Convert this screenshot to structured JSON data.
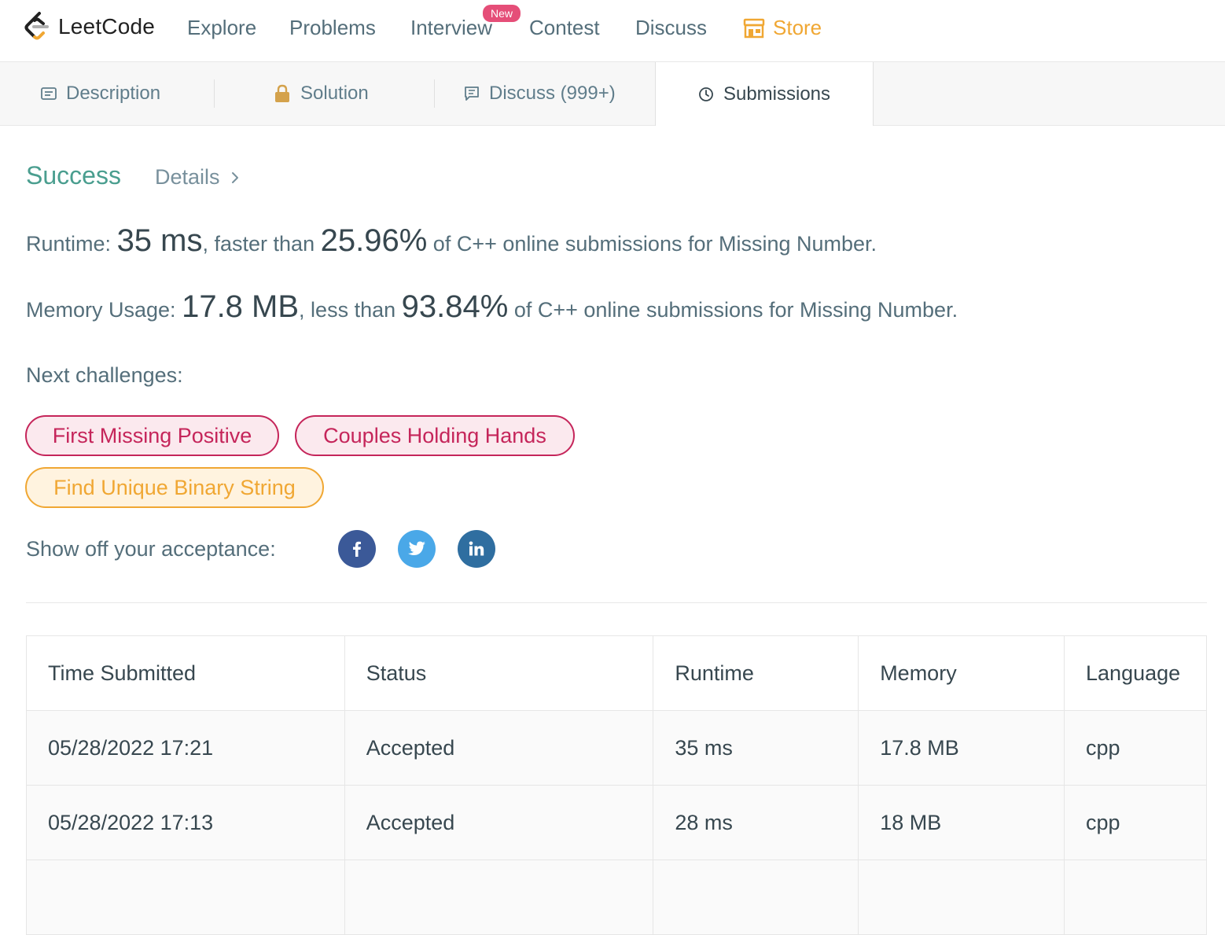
{
  "nav": {
    "logo_text": "LeetCode",
    "items": [
      "Explore",
      "Problems",
      "Interview",
      "Contest",
      "Discuss"
    ],
    "new_badge": "New",
    "store_label": "Store",
    "store_color": "#f0a733"
  },
  "tabs": [
    {
      "label": "Description",
      "icon": "description-icon"
    },
    {
      "label": "Solution",
      "icon": "lock-icon"
    },
    {
      "label": "Discuss (999+)",
      "icon": "discuss-icon"
    },
    {
      "label": "Submissions",
      "icon": "clock-icon",
      "active": true
    }
  ],
  "result": {
    "status": "Success",
    "details_label": "Details",
    "runtime_label": "Runtime:",
    "runtime_value": "35 ms",
    "runtime_mid": ", faster than",
    "runtime_pct": "25.96%",
    "runtime_tail": "of C++ online submissions for Missing Number.",
    "memory_label": "Memory Usage:",
    "memory_value": "17.8 MB",
    "memory_mid": ", less than",
    "memory_pct": "93.84%",
    "memory_tail": "of C++ online submissions for Missing Number.",
    "success_color": "#4a9e8f"
  },
  "next": {
    "label": "Next challenges:",
    "challenges": [
      {
        "title": "First Missing Positive",
        "difficulty": "hard",
        "color": "#c5255a"
      },
      {
        "title": "Couples Holding Hands",
        "difficulty": "hard",
        "color": "#c5255a"
      },
      {
        "title": "Find Unique Binary String",
        "difficulty": "medium",
        "color": "#f0a733"
      }
    ]
  },
  "share": {
    "label": "Show off your acceptance:",
    "networks": [
      {
        "icon": "facebook-icon",
        "color": "#3b5998"
      },
      {
        "icon": "twitter-icon",
        "color": "#4aa8e8"
      },
      {
        "icon": "linkedin-icon",
        "color": "#2f6ea0"
      }
    ]
  },
  "submissions": {
    "headers": [
      "Time Submitted",
      "Status",
      "Runtime",
      "Memory",
      "Language"
    ],
    "rows": [
      [
        "05/28/2022 17:21",
        "Accepted",
        "35 ms",
        "17.8 MB",
        "cpp"
      ],
      [
        "05/28/2022 17:13",
        "Accepted",
        "28 ms",
        "18 MB",
        "cpp"
      ]
    ]
  }
}
